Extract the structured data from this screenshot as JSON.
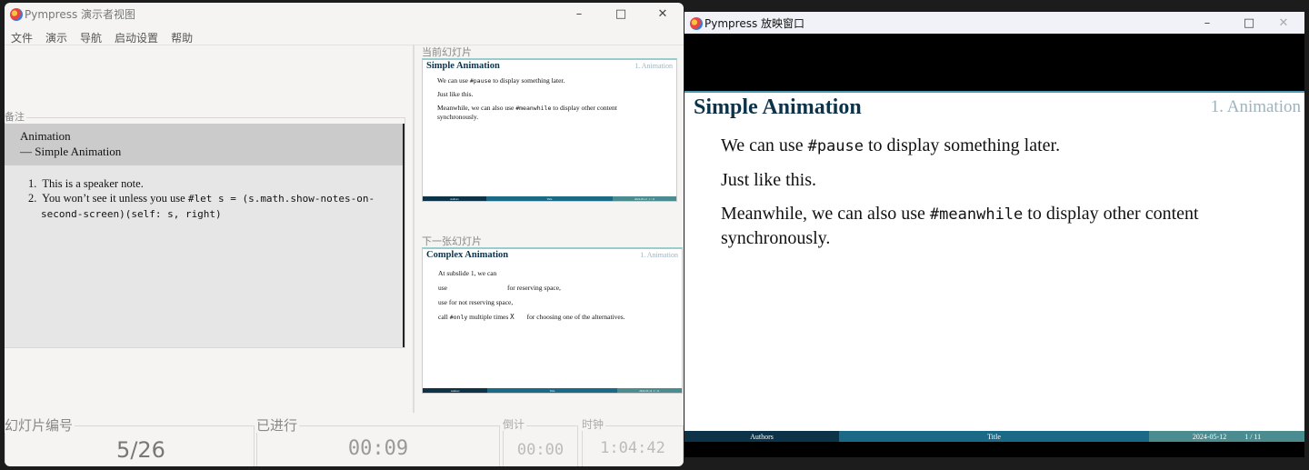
{
  "presenter": {
    "title": "Pympress 演示者视图",
    "menu": [
      "文件",
      "演示",
      "导航",
      "启动设置",
      "帮助"
    ],
    "notes": {
      "label": "备注",
      "header": [
        "Animation",
        "— Simple Animation"
      ],
      "items": [
        {
          "num": "1.",
          "text": "This is a speaker note."
        },
        {
          "num": "2.",
          "text": "You won’t see it unless you use ",
          "code": "#let s = (s.math.show-notes-on-",
          "code2": "second-screen)(self: s, right)"
        }
      ]
    },
    "current": {
      "label": "当前幻灯片",
      "title": "Simple Animation",
      "section": "1. Animation",
      "lines": [
        [
          "We can use ",
          "#pause",
          " to display something later."
        ],
        [
          "Just like this."
        ],
        [
          "Meanwhile, we can also use ",
          "#meanwhile",
          " to display other content"
        ],
        [
          "synchronously."
        ]
      ]
    },
    "next": {
      "label": "下一张幻灯片",
      "title": "Complex Animation",
      "section": "1. Animation",
      "lines": [
        "At subslide 1, we can",
        "use",
        "for reserving space,",
        "use for not reserving space,",
        "call ",
        "#only",
        " multiple times ",
        "X",
        "for choosing one of the alternatives."
      ]
    },
    "footer": {
      "authors": "Authors",
      "title": "Title",
      "date": "2024-05-12",
      "page": "1 / 11",
      "next_page": "2 / 11"
    },
    "status": {
      "slide_label": "幻灯片编号",
      "slide_value": "5/26",
      "elapsed_label": "已进行",
      "elapsed_value": "00:09",
      "countdown_label": "倒计",
      "countdown_value": "00:00",
      "clock_label": "时钟",
      "clock_value": "1:04:42"
    }
  },
  "projector": {
    "title": "Pympress 放映窗口"
  },
  "colors": {
    "footer_dark": "#0d3349",
    "footer_mid": "#1a6a87",
    "footer_light": "#4a8c90",
    "title": "#0d3349"
  }
}
